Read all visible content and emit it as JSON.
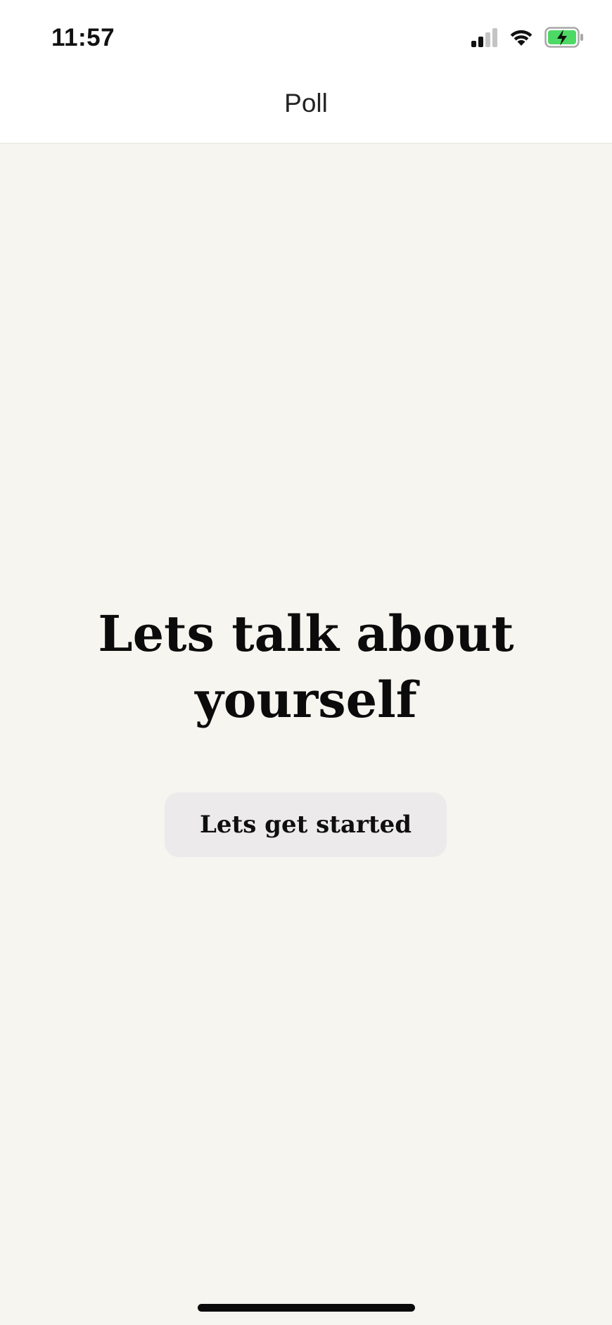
{
  "status_bar": {
    "time": "11:57",
    "signal_icon": "cellular-signal-icon",
    "wifi_icon": "wifi-icon",
    "battery_icon": "battery-charging-icon",
    "battery_color": "#4cd964"
  },
  "nav": {
    "title": "Poll"
  },
  "main": {
    "headline_line1": "Lets talk about",
    "headline_line2": "yourself",
    "start_button_label": "Lets get started"
  },
  "colors": {
    "background": "#f6f5f0",
    "header_background": "#ffffff",
    "button_background": "#eceaea",
    "text": "#0b0b0b"
  }
}
